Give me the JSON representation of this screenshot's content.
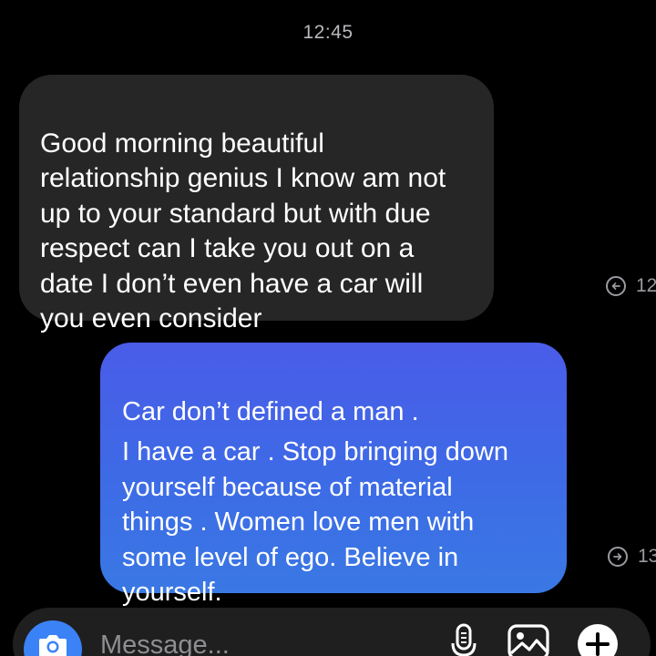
{
  "status": {
    "time": "12:45"
  },
  "messages": [
    {
      "direction": "incoming",
      "text": "Good morning beautiful\nrelationship genius I know am not\nup to your standard but with due\nrespect can I take you out on a\ndate I don’t even have a car will\nyou even consider",
      "meta_time": "12"
    },
    {
      "direction": "outgoing",
      "first_line": "Car don’t defined a man .",
      "text": "I have a car . Stop bringing down\nyourself because of material\nthings . Women love men with\nsome level of ego. Believe in\nyourself.",
      "meta_time": "13"
    }
  ],
  "composer": {
    "placeholder": "Message...",
    "icons": [
      "camera-icon",
      "microphone-icon",
      "gallery-icon",
      "add-icon"
    ]
  },
  "colors": {
    "background": "#000000",
    "incoming_bubble": "#262626",
    "outgoing_bubble_top": "#4a5ce8",
    "outgoing_bubble_bottom": "#3a78e4",
    "camera_button": "#3b82f6"
  }
}
